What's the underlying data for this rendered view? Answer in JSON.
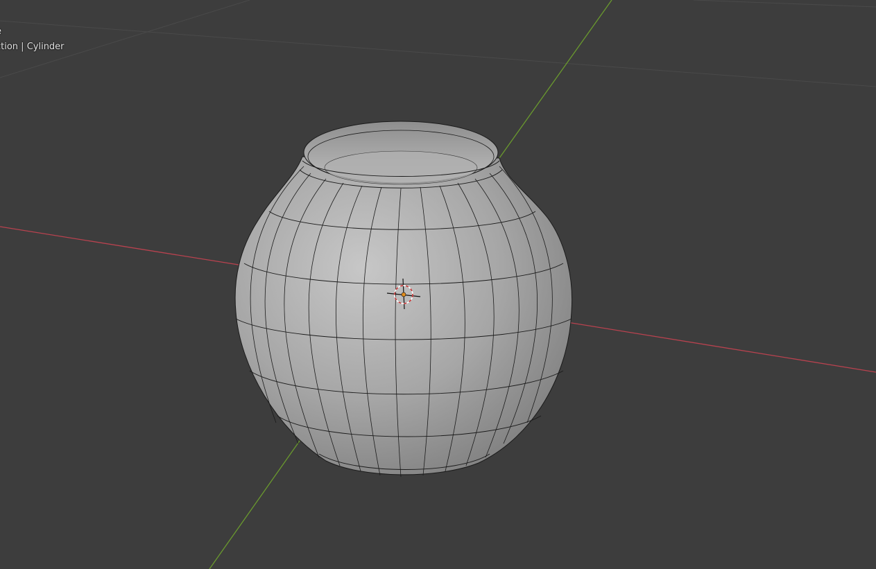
{
  "viewport": {
    "overlay": {
      "mode_line": "e",
      "collection_line": "ction | Cylinder"
    },
    "colors": {
      "background": "#3d3d3d",
      "grid_line": "#4d4d4d",
      "x_axis": "#b9424f",
      "y_axis": "#6a9a2e",
      "mesh_edge": "#1a1a1a"
    },
    "object": {
      "name": "Cylinder",
      "type": "vase-mesh"
    }
  }
}
